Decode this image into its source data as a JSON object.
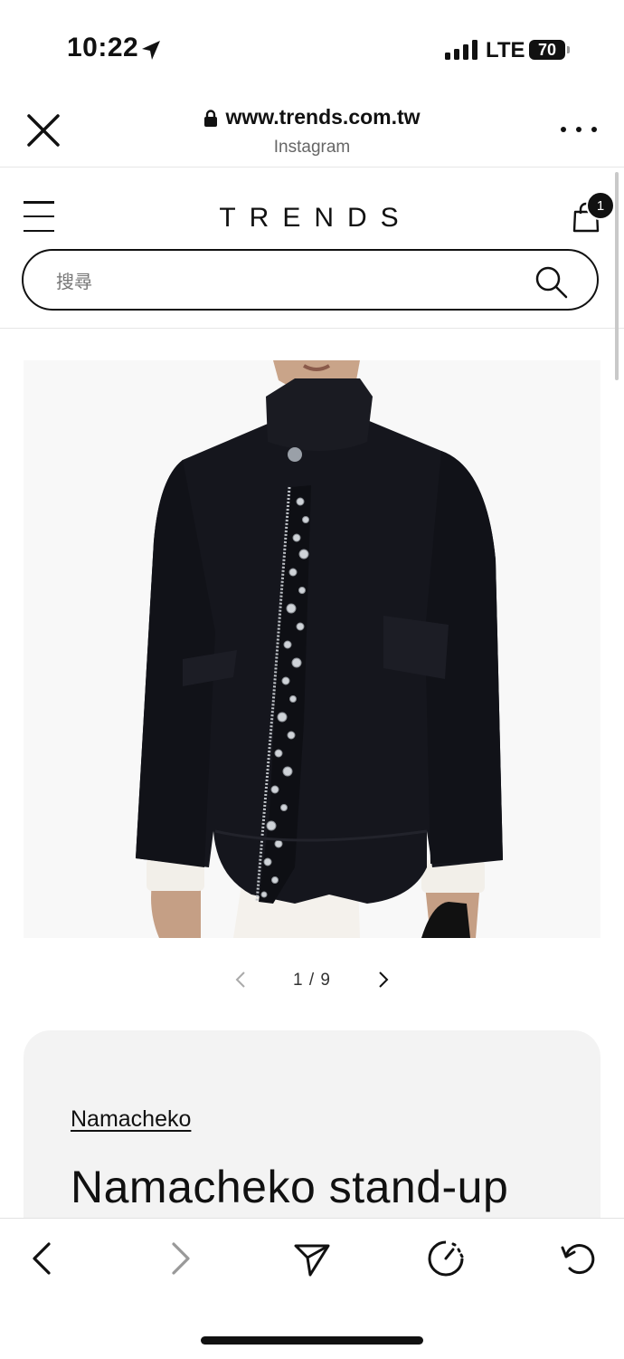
{
  "status_bar": {
    "time": "10:22",
    "network": "LTE",
    "battery": "70"
  },
  "browser": {
    "url": "www.trends.com.tw",
    "source": "Instagram"
  },
  "site": {
    "logo": "TRENDS",
    "cart_count": "1",
    "search_placeholder": "搜尋"
  },
  "gallery": {
    "pager": "1 / 9"
  },
  "product": {
    "brand": "Namacheko",
    "title": "Namacheko stand-up"
  },
  "colors": {
    "jacket": "#15161d",
    "background": "#ffffff",
    "card": "#f3f3f3"
  },
  "icons": {
    "close": "close-icon",
    "lock": "lock-icon",
    "more": "more-icon",
    "menu": "hamburger-icon",
    "cart": "shopping-bag-icon",
    "search": "search-icon",
    "back": "chevron-left-icon",
    "forward": "chevron-right-icon",
    "share": "send-icon",
    "speed": "speed-icon",
    "reload": "reload-icon"
  }
}
